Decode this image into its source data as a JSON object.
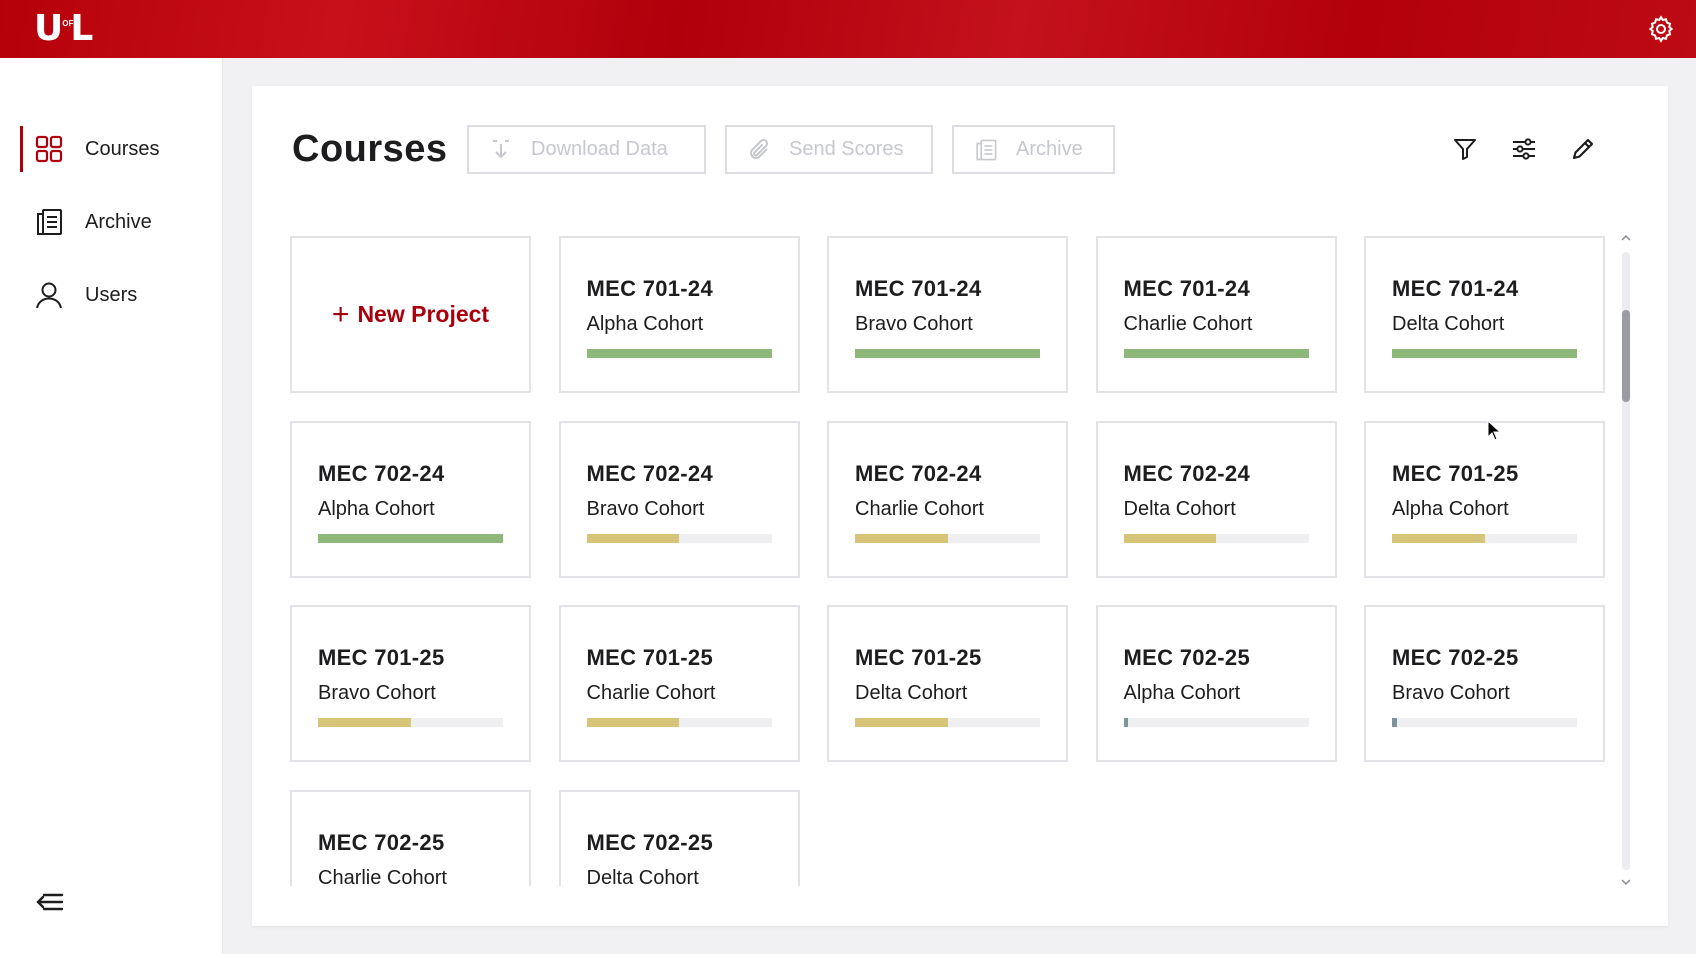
{
  "header": {
    "logo_u": "U",
    "logo_of": "OF",
    "logo_l": "L",
    "settings_icon": "gear-icon"
  },
  "sidebar": {
    "items": [
      {
        "label": "Courses",
        "icon": "grid-icon",
        "active": true
      },
      {
        "label": "Archive",
        "icon": "archive-icon",
        "active": false
      },
      {
        "label": "Users",
        "icon": "user-icon",
        "active": false
      }
    ],
    "collapse_icon": "collapse-menu-icon"
  },
  "main": {
    "title": "Courses",
    "actions": {
      "download": "Download Data",
      "send_scores": "Send Scores",
      "archive": "Archive"
    },
    "tool_icons": [
      "filter-icon",
      "sliders-icon",
      "edit-icon"
    ],
    "new_project": "New Project",
    "courses": [
      {
        "code": "MEC 701-24",
        "cohort": "Alpha Cohort",
        "progress": 1.0,
        "status": "complete"
      },
      {
        "code": "MEC 701-24",
        "cohort": "Bravo Cohort",
        "progress": 1.0,
        "status": "complete"
      },
      {
        "code": "MEC 701-24",
        "cohort": "Charlie Cohort",
        "progress": 1.0,
        "status": "complete"
      },
      {
        "code": "MEC 701-24",
        "cohort": "Delta Cohort",
        "progress": 1.0,
        "status": "complete"
      },
      {
        "code": "MEC 702-24",
        "cohort": "Alpha Cohort",
        "progress": 1.0,
        "status": "complete"
      },
      {
        "code": "MEC 702-24",
        "cohort": "Bravo Cohort",
        "progress": 0.5,
        "status": "in-progress"
      },
      {
        "code": "MEC 702-24",
        "cohort": "Charlie Cohort",
        "progress": 0.5,
        "status": "in-progress"
      },
      {
        "code": "MEC 702-24",
        "cohort": "Delta Cohort",
        "progress": 0.5,
        "status": "in-progress"
      },
      {
        "code": "MEC 701-25",
        "cohort": "Alpha Cohort",
        "progress": 0.5,
        "status": "in-progress"
      },
      {
        "code": "MEC 701-25",
        "cohort": "Bravo Cohort",
        "progress": 0.5,
        "status": "in-progress"
      },
      {
        "code": "MEC 701-25",
        "cohort": "Charlie Cohort",
        "progress": 0.5,
        "status": "in-progress"
      },
      {
        "code": "MEC 701-25",
        "cohort": "Delta Cohort",
        "progress": 0.5,
        "status": "in-progress"
      },
      {
        "code": "MEC 702-25",
        "cohort": "Alpha Cohort",
        "progress": 0.02,
        "status": "started"
      },
      {
        "code": "MEC 702-25",
        "cohort": "Bravo Cohort",
        "progress": 0.02,
        "status": "started"
      },
      {
        "code": "MEC 702-25",
        "cohort": "Charlie Cohort",
        "progress": null,
        "status": "unknown"
      },
      {
        "code": "MEC 702-25",
        "cohort": "Delta Cohort",
        "progress": null,
        "status": "unknown"
      }
    ]
  },
  "colors": {
    "brand_red": "#b1000d",
    "complete": "#8db87a",
    "in_progress": "#d6c478",
    "started": "#7f949a",
    "track": "#efeff1"
  }
}
